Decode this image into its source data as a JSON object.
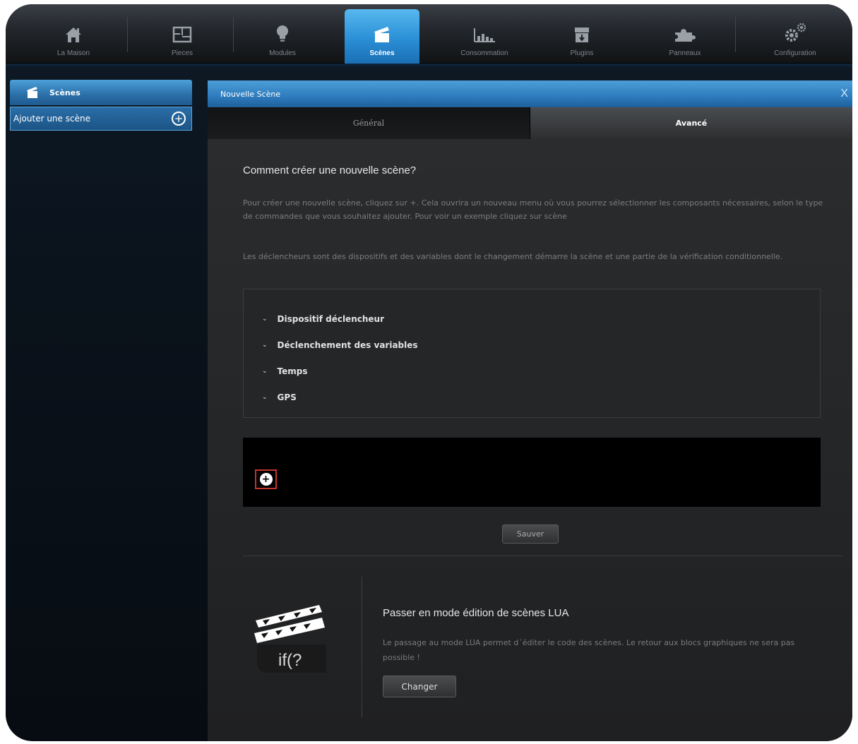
{
  "nav": {
    "items": [
      {
        "label": "La Maison",
        "icon": "house-icon"
      },
      {
        "label": "Pieces",
        "icon": "floorplan-icon"
      },
      {
        "label": "Modules",
        "icon": "lightbulb-icon"
      },
      {
        "label": "Scènes",
        "icon": "clapperboard-icon",
        "active": true
      },
      {
        "label": "Consommation",
        "icon": "bar-chart-icon"
      },
      {
        "label": "Plugins",
        "icon": "box-download-icon"
      },
      {
        "label": "Panneaux",
        "icon": "puzzle-icon"
      },
      {
        "label": "Configuration",
        "icon": "gears-icon"
      }
    ]
  },
  "sidebar": {
    "header": "Scènes",
    "add_label": "Ajouter une scène"
  },
  "panel": {
    "title": "Nouvelle Scène",
    "close": "X",
    "tabs": {
      "general": "Général",
      "advanced": "Avancé"
    },
    "heading": "Comment créer une nouvelle scène?",
    "para1": "Pour créer une nouvelle scène, cliquez sur +. Cela ouvrira un nouveau menu où vous pourrez sélectionner les composants nécessaires, selon le type de commandes que vous souhaitez ajouter. Pour voir un exemple cliquez sur scène",
    "para2": "Les déclencheurs sont des dispositifs et des variables dont le changement démarre la scène et une partie de la vérification conditionnelle.",
    "triggers": [
      "Dispositif déclencheur",
      "Déclenchement des variables",
      "Temps",
      "GPS"
    ],
    "add_block": "+",
    "save": "Sauver",
    "lua": {
      "icon_text": "if(?",
      "title": "Passer en mode édition de scènes LUA",
      "desc": "Le passage au mode LUA permet d´éditer le code des scènes. Le retour aux blocs graphiques ne sera pas possible !",
      "button": "Changer"
    }
  },
  "colors": {
    "accent": "#2a8fd6",
    "highlight_border": "#c2352c"
  }
}
